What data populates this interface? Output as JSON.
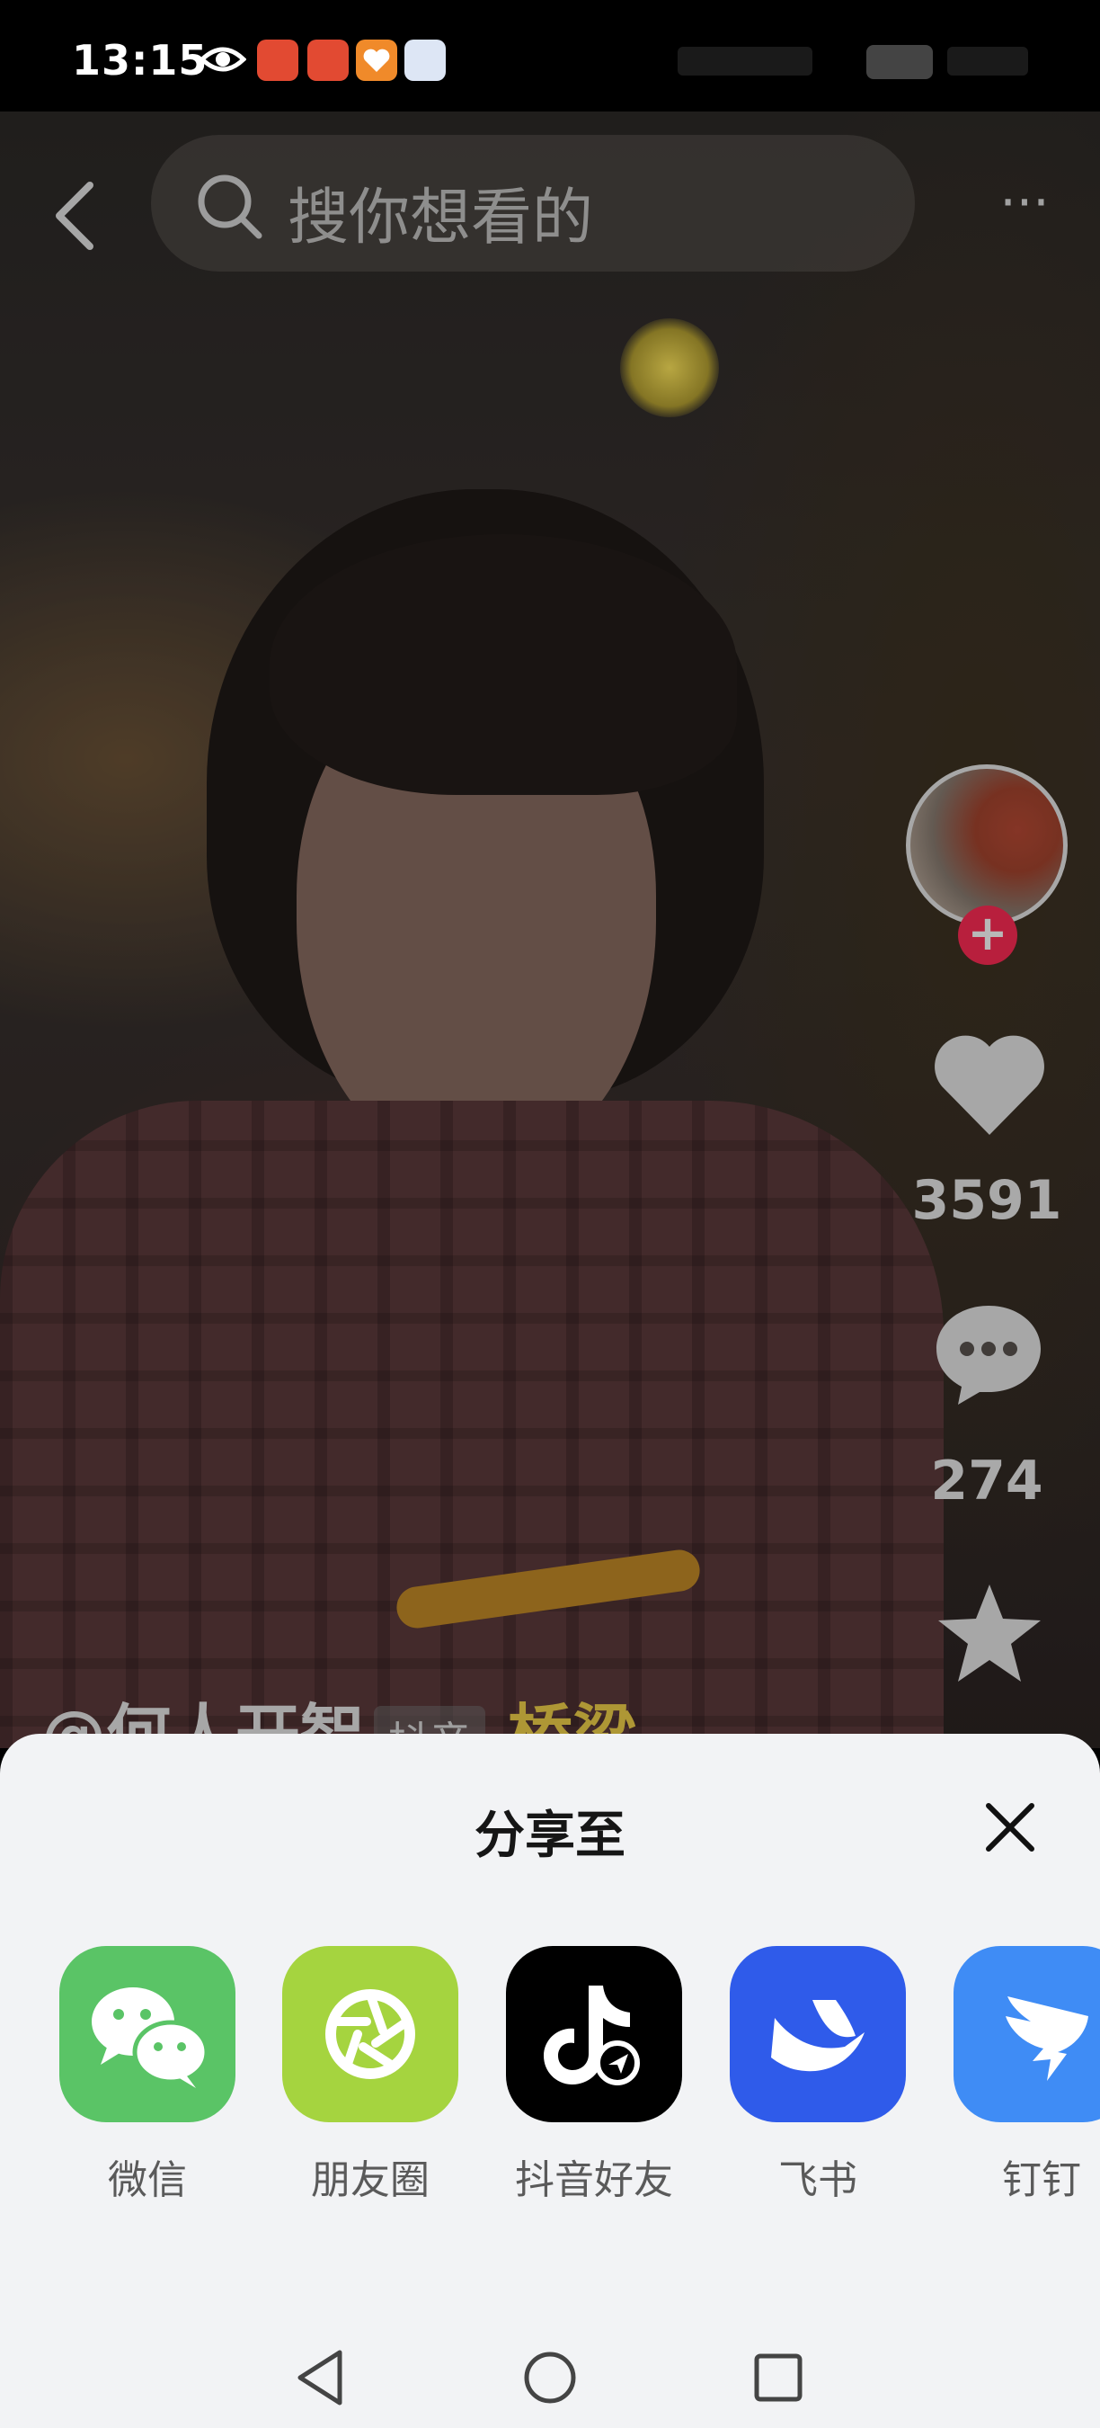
{
  "status_bar": {
    "time": "13:15"
  },
  "video": {
    "search_placeholder": "搜你想看的",
    "more_label": "···",
    "likes_count": "3591",
    "comments_count": "274",
    "author_caption": "@何人开智",
    "caption_chip": "抖音",
    "caption_highlight": "桥梁"
  },
  "share_sheet": {
    "title": "分享至",
    "targets": [
      {
        "label": "微信",
        "icon": "wechat-icon",
        "color": "#5ac466"
      },
      {
        "label": "朋友圈",
        "icon": "moments-icon",
        "color": "#a5d43f"
      },
      {
        "label": "抖音好友",
        "icon": "douyin-icon",
        "color": "#000000"
      },
      {
        "label": "飞书",
        "icon": "feishu-icon",
        "color": "#2f5bea"
      },
      {
        "label": "钉钉",
        "icon": "dingtalk-icon",
        "color": "#3f8cf5"
      }
    ]
  },
  "colors": {
    "accent_follow": "#ff2c55",
    "sheet_bg": "#f2f3f5"
  }
}
